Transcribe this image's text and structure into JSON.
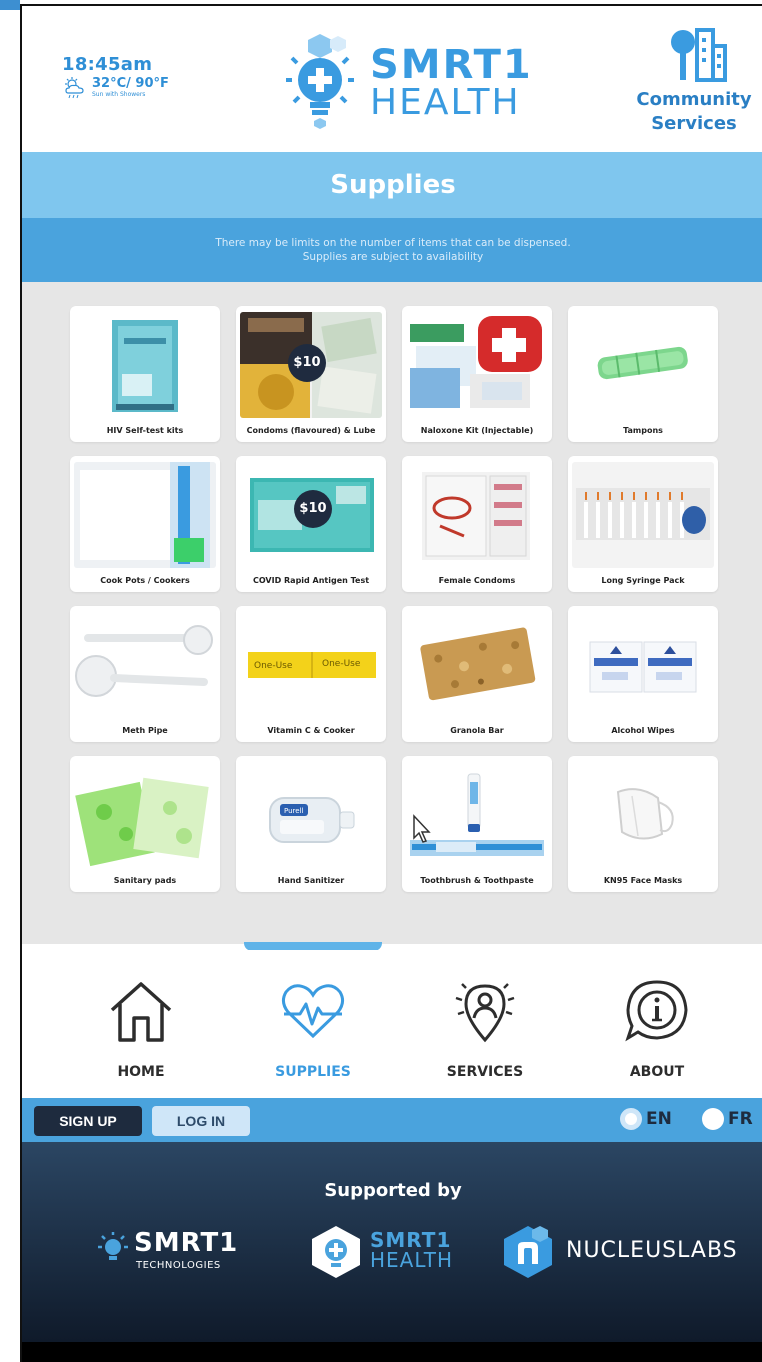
{
  "header": {
    "time": "18:45am",
    "temperature": "32°C/ 90°F",
    "condition": "Sun with Showers",
    "logo_line1": "SMRT1",
    "logo_line2": "HEALTH",
    "community_line1": "Community",
    "community_line2": "Services"
  },
  "page": {
    "title": "Supplies",
    "notice_line1": "There may be limits on the number of items that can be dispensed.",
    "notice_line2": "Supplies are subject to availability"
  },
  "supplies": [
    {
      "label": "HIV Self-test kits",
      "icon": "hiv-test-kit-image"
    },
    {
      "label": "Condoms (flavoured) & Lube",
      "icon": "condoms-image",
      "price": "$10"
    },
    {
      "label": "Naloxone Kit (Injectable)",
      "icon": "naloxone-kit-image"
    },
    {
      "label": "Tampons",
      "icon": "tampons-image"
    },
    {
      "label": "Cook Pots / Cookers",
      "icon": "cook-pots-image"
    },
    {
      "label": "COVID Rapid Antigen Test",
      "icon": "covid-test-image",
      "price": "$10"
    },
    {
      "label": "Female Condoms",
      "icon": "female-condoms-image"
    },
    {
      "label": "Long Syringe Pack",
      "icon": "syringe-pack-image"
    },
    {
      "label": "Meth Pipe",
      "icon": "pipe-image"
    },
    {
      "label": "Vitamin C & Cooker",
      "icon": "vitamin-c-image",
      "packet_text": "One-Use"
    },
    {
      "label": "Granola Bar",
      "icon": "granola-bar-image"
    },
    {
      "label": "Alcohol Wipes",
      "icon": "alcohol-wipes-image"
    },
    {
      "label": "Sanitary pads",
      "icon": "sanitary-pads-image"
    },
    {
      "label": "Hand Sanitizer",
      "icon": "hand-sanitizer-image",
      "bottle_text": "Purell"
    },
    {
      "label": "Toothbrush & Toothpaste",
      "icon": "toothbrush-image"
    },
    {
      "label": "KN95 Face Masks",
      "icon": "face-mask-image"
    }
  ],
  "nav": {
    "home": "HOME",
    "supplies": "SUPPLIES",
    "services": "SERVICES",
    "about": "ABOUT",
    "active": "supplies"
  },
  "auth": {
    "signup": "SIGN UP",
    "login": "LOG IN"
  },
  "language": {
    "en": "EN",
    "fr": "FR",
    "selected": "en"
  },
  "footer": {
    "supported_by": "Supported by",
    "sponsor1_name": "SMRT1",
    "sponsor1_sub": "TECHNOLOGIES",
    "sponsor2_line1": "SMRT1",
    "sponsor2_line2": "HEALTH",
    "sponsor3_name": "NUCLEUSLABS"
  },
  "colors": {
    "brand_blue": "#3a9be0",
    "title_band": "#7fc6ee",
    "notice_band": "#4aa3dd",
    "dark_navy": "#1e2b3e",
    "grid_bg": "#e6e6e6"
  }
}
